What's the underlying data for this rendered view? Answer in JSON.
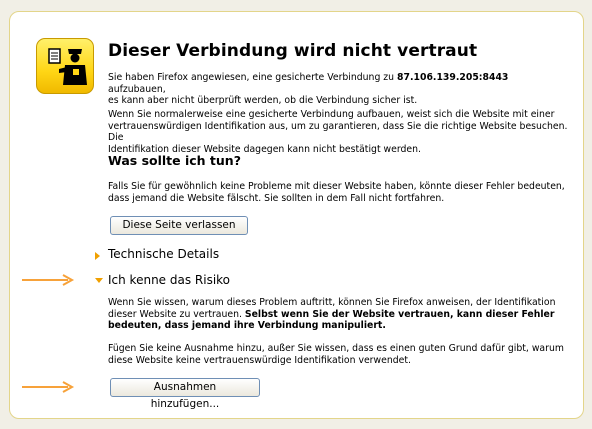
{
  "error": {
    "title": "Dieser Verbindung wird nicht vertraut",
    "intro_before": "Sie haben Firefox angewiesen, eine gesicherte Verbindung zu ",
    "host": "87.106.139.205:8443",
    "intro_after": " aufzubauen,",
    "intro_line2": "es kann aber nicht überprüft werden, ob die Verbindung sicher ist.",
    "para2_line1": "Wenn Sie normalerweise eine gesicherte Verbindung aufbauen, weist sich die Website mit einer",
    "para2_line2": "vertrauenswürdigen Identifikation aus, um zu garantieren, dass Sie die richtige Website besuchen. Die",
    "para2_line3": "Identifikation dieser Website dagegen kann nicht bestätigt werden."
  },
  "what_to_do": {
    "heading": "Was sollte ich tun?",
    "line1": "Falls Sie für gewöhnlich keine Probleme mit dieser Website haben, könnte dieser Fehler bedeuten,",
    "line2": "dass jemand die Website fälscht. Sie sollten in dem Fall nicht fortfahren.",
    "leave_button": "Diese Seite verlassen"
  },
  "technical": {
    "label": "Technische Details"
  },
  "risk": {
    "label": "Ich kenne das Risiko",
    "line1": "Wenn Sie wissen, warum dieses Problem auftritt, können Sie Firefox anweisen, der Identifikation",
    "line2_before": "dieser Website zu vertrauen. ",
    "line2_bold": "Selbst wenn Sie der Website vertrauen, kann dieser Fehler",
    "line3_bold": "bedeuten, dass jemand ihre Verbindung manipuliert.",
    "para2_line1": "Fügen Sie keine Ausnahme hinzu, außer Sie wissen, dass es einen guten Grund dafür gibt, warum",
    "para2_line2": "diese Website keine vertrauenswürdige Identifikation verwendet.",
    "add_exception_button": "Ausnahmen hinzufügen..."
  },
  "colors": {
    "accent_orange": "#f0a000",
    "arrow_orange": "#f7a23a",
    "panel_border": "#e3d58a"
  }
}
